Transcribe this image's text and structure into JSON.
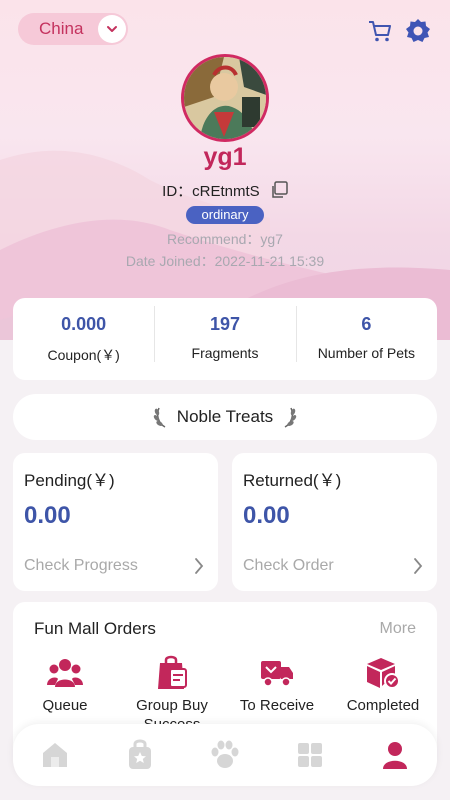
{
  "header": {
    "region": "China",
    "icons": [
      "chevron-down-icon",
      "cart-icon",
      "gear-icon"
    ]
  },
  "profile": {
    "username": "yg1",
    "id_text": "ID：cREtnmtS",
    "level": "ordinary",
    "recommend": "Recommend：yg7",
    "date_joined": "Date Joined：2022-11-21 15:39"
  },
  "stats": [
    {
      "value": "0.000",
      "label": "Coupon(￥)"
    },
    {
      "value": "197",
      "label": "Fragments"
    },
    {
      "value": "6",
      "label": "Number of Pets"
    }
  ],
  "noble": {
    "label": "Noble Treats"
  },
  "cards": {
    "pending": {
      "title": "Pending(￥)",
      "value": "0.00",
      "link": "Check Progress"
    },
    "returned": {
      "title": "Returned(￥)",
      "value": "0.00",
      "link": "Check Order"
    }
  },
  "orders": {
    "title": "Fun Mall Orders",
    "more": "More",
    "items": [
      {
        "label": "Queue",
        "icon": "queue-icon"
      },
      {
        "label": "Group Buy Success",
        "icon": "group-buy-icon"
      },
      {
        "label": "To Receive",
        "icon": "truck-icon"
      },
      {
        "label": "Completed",
        "icon": "completed-box-icon"
      }
    ]
  },
  "tabbar": {
    "tabs": [
      "home-tab-icon",
      "bag-tab-icon",
      "paw-tab-icon",
      "grid-tab-icon",
      "profile-tab-icon"
    ],
    "active_index": 4
  },
  "colors": {
    "accent": "#c2275b",
    "blue": "#3e55a8",
    "badge": "#4a62c2",
    "muted": "#a9a9a9"
  }
}
